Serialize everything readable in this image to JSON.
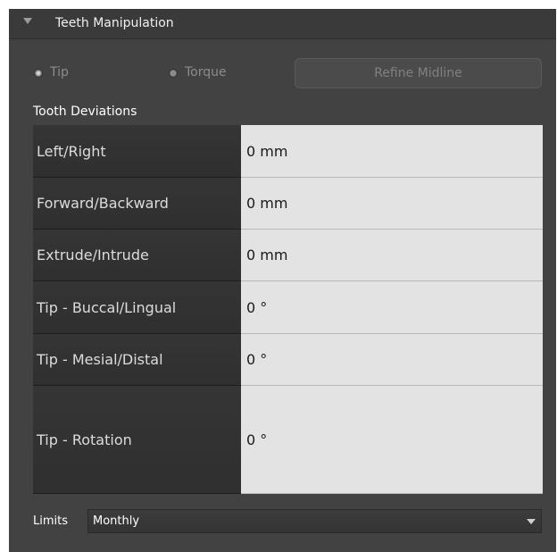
{
  "panel": {
    "title": "Teeth Manipulation",
    "expand_icon": "triangle-down-icon"
  },
  "mode": {
    "options": [
      {
        "label": "Tip",
        "selected": true
      },
      {
        "label": "Torque",
        "selected": false
      }
    ],
    "refine_button_label": "Refine Midline"
  },
  "deviations": {
    "heading": "Tooth Deviations",
    "rows": [
      {
        "label": "Left/Right",
        "value": "0 mm"
      },
      {
        "label": "Forward/Backward",
        "value": "0 mm"
      },
      {
        "label": "Extrude/Intrude",
        "value": "0 mm"
      },
      {
        "label": "Tip - Buccal/Lingual",
        "value": "0 °"
      },
      {
        "label": "Tip - Mesial/Distal",
        "value": "0 °"
      },
      {
        "label": "Tip - Rotation",
        "value": "0 °"
      }
    ]
  },
  "limits": {
    "label": "Limits",
    "selected": "Monthly"
  },
  "colors": {
    "panel_bg": "#424242",
    "label_cell_bg": "#333333",
    "value_cell_bg": "#e3e3e3"
  }
}
